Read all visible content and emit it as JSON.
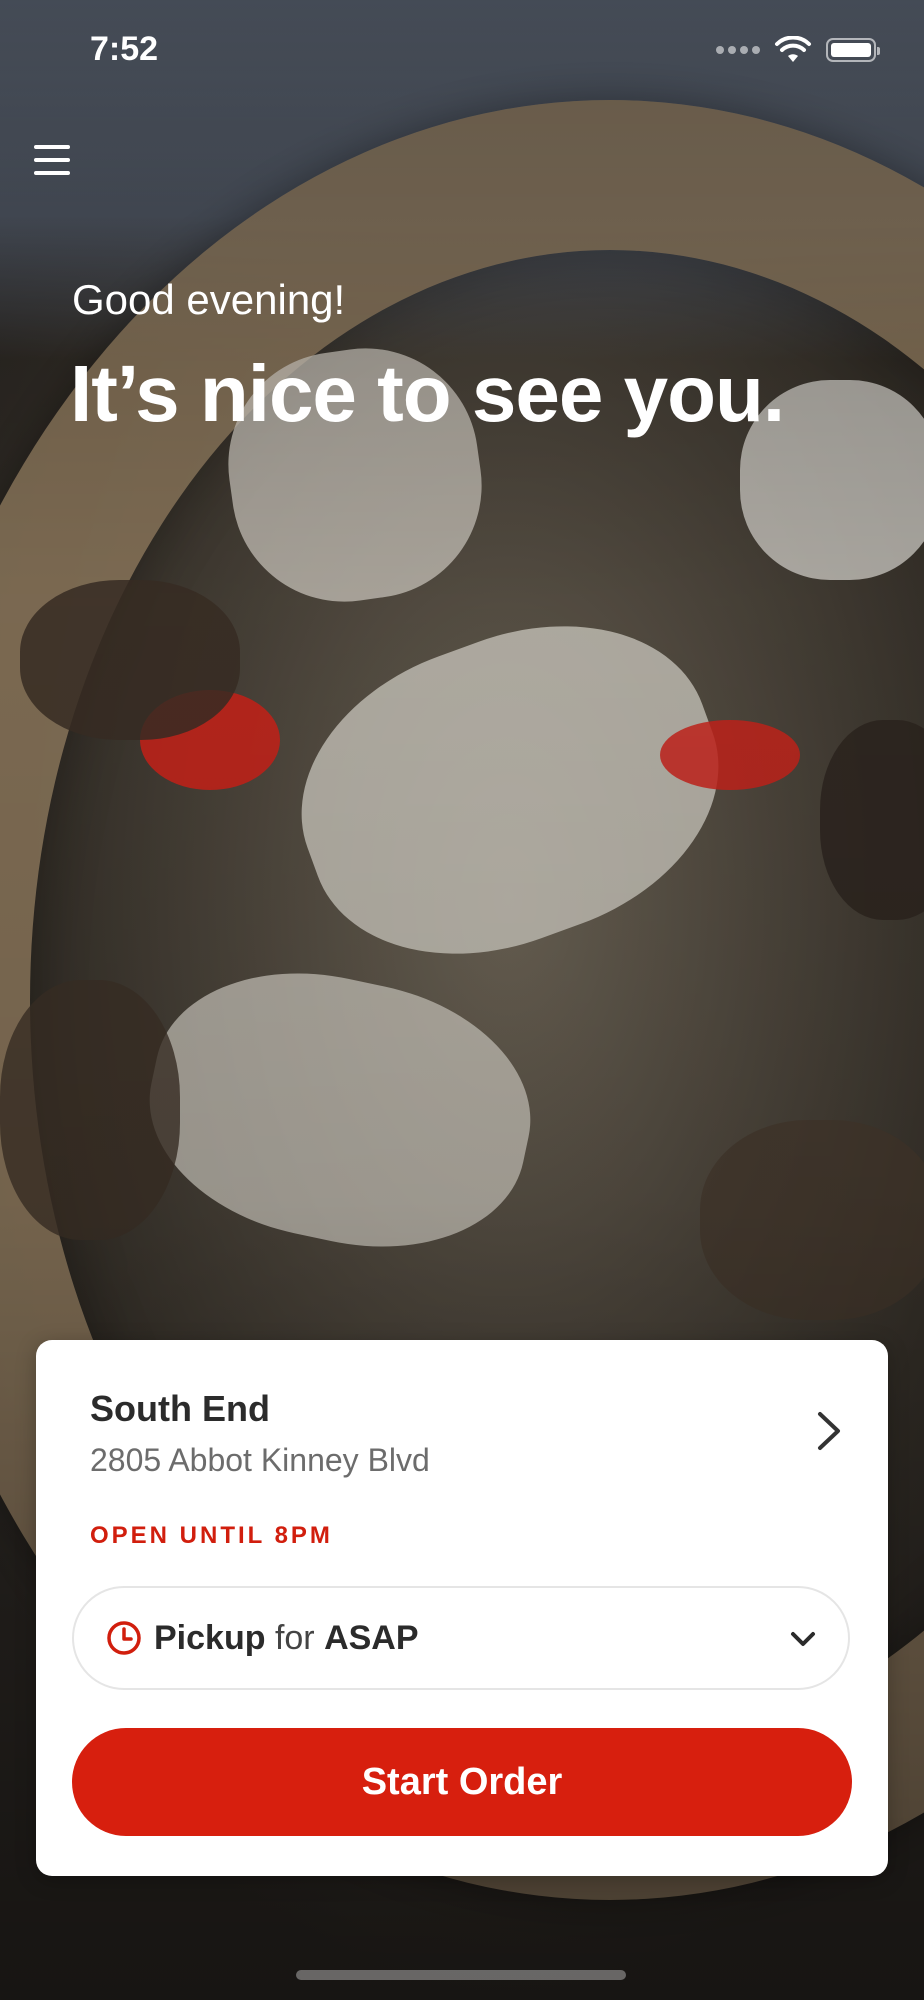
{
  "status_bar": {
    "time": "7:52"
  },
  "header": {
    "menu_icon": "hamburger-menu-icon",
    "greeting": "Good evening!",
    "headline": "It’s nice to see you."
  },
  "location_card": {
    "name": "South End",
    "address": "2805 Abbot Kinney Blvd",
    "open_status": "OPEN UNTIL 8PM",
    "order_mode": {
      "icon": "clock-icon",
      "mode": "Pickup",
      "connector": "for",
      "time": "ASAP"
    },
    "start_button_label": "Start Order"
  },
  "colors": {
    "brand_red": "#d71f0e",
    "text_dark": "#2b2b2b",
    "text_muted": "#6c6c6c"
  }
}
